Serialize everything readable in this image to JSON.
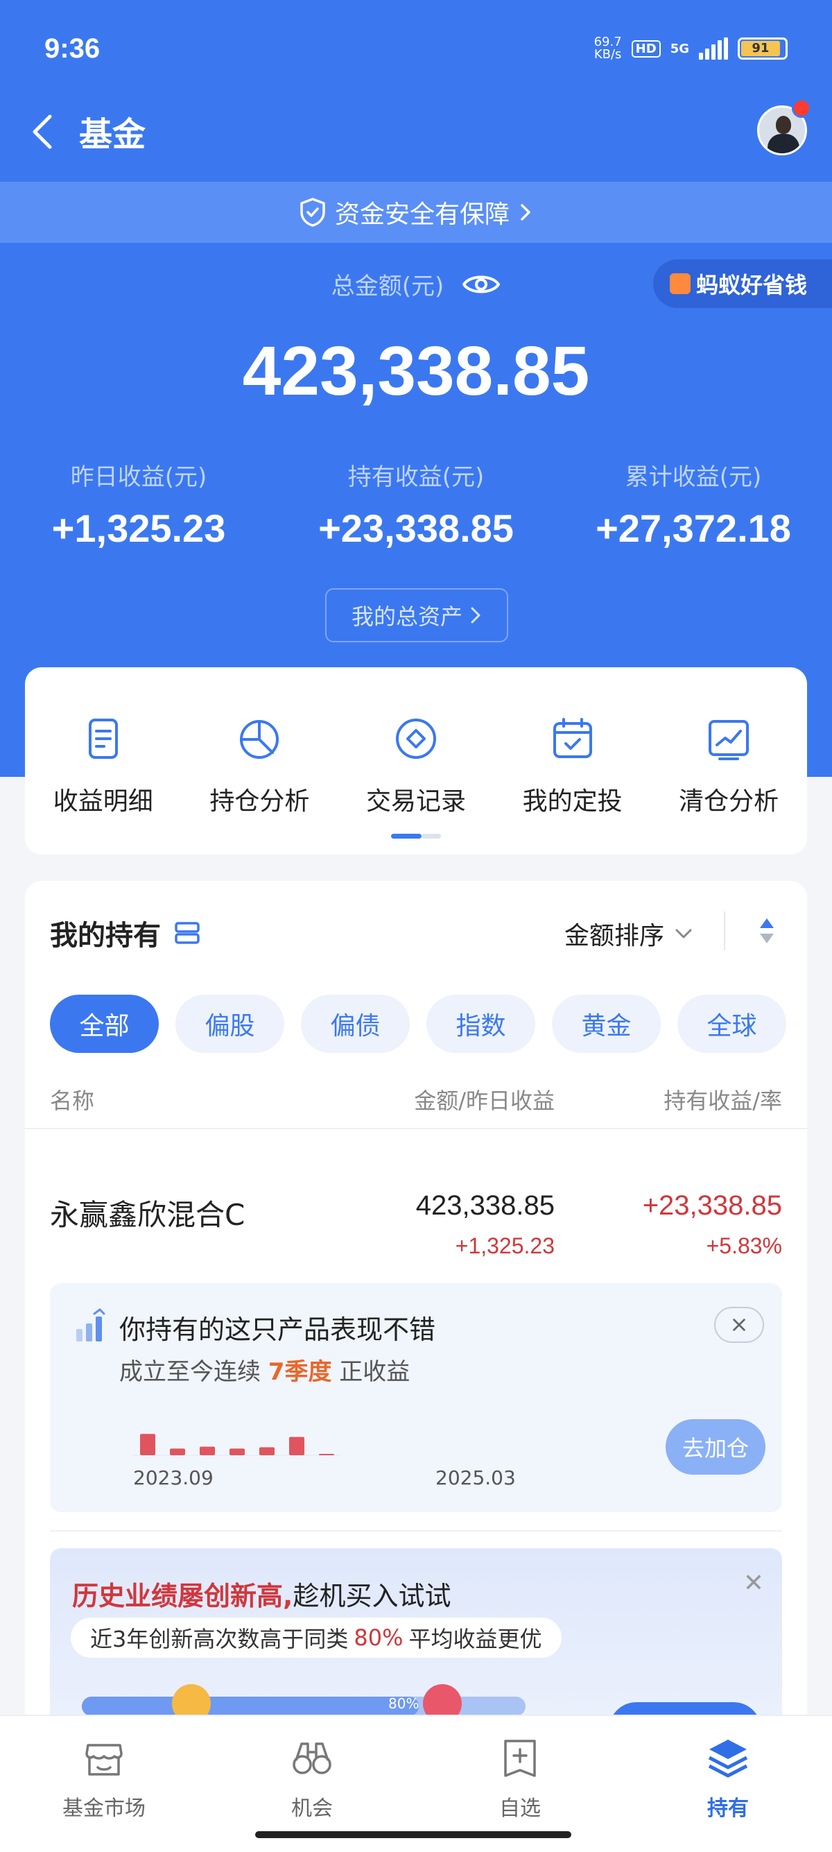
{
  "status_bar": {
    "time": "9:36",
    "net_speed_top": "69.7",
    "net_speed_bottom": "KB/s",
    "hd": "HD",
    "network": "5G",
    "battery": "91"
  },
  "nav": {
    "title": "基金"
  },
  "safety_banner": {
    "text": "资金安全有保障"
  },
  "summary": {
    "total_label": "总金额(元)",
    "total_amount": "423,338.85",
    "badge": "蚂蚁好省钱",
    "stats": [
      {
        "label": "昨日收益(元)",
        "value": "+1,325.23"
      },
      {
        "label": "持有收益(元)",
        "value": "+23,338.85"
      },
      {
        "label": "累计收益(元)",
        "value": "+27,372.18"
      }
    ],
    "assets_button": "我的总资产"
  },
  "tools": [
    {
      "label": "收益明细",
      "icon": "document-icon"
    },
    {
      "label": "持仓分析",
      "icon": "pie-chart-icon"
    },
    {
      "label": "交易记录",
      "icon": "diamond-circle-icon"
    },
    {
      "label": "我的定投",
      "icon": "calendar-check-icon"
    },
    {
      "label": "清仓分析",
      "icon": "line-chart-icon"
    }
  ],
  "holdings": {
    "title": "我的持有",
    "sort_label": "金额排序",
    "filters": [
      "全部",
      "偏股",
      "偏债",
      "指数",
      "黄金",
      "全球"
    ],
    "active_filter": "全部",
    "columns": {
      "name": "名称",
      "amount": "金额/昨日收益",
      "profit": "持有收益/率"
    },
    "funds": [
      {
        "name": "永赢鑫欣混合C",
        "amount": "423,338.85",
        "yesterday": "+1,325.23",
        "hold_profit": "+23,338.85",
        "hold_rate": "+5.83%"
      }
    ]
  },
  "performance_card": {
    "title": "你持有的这只产品表现不错",
    "sub_prefix": "成立至今连续",
    "sub_highlight": "7季度",
    "sub_suffix": "正收益",
    "x_start": "2023.09",
    "x_end": "2025.03",
    "quarterly_bars": [
      0.7,
      0.22,
      0.28,
      0.22,
      0.26,
      0.6,
      0.04
    ],
    "button": "去加仓"
  },
  "promo": {
    "title_red": "历史业绩屡创新高,",
    "title_rest": "趁机买入试试",
    "pill_prefix": "近3年创新高次数高于同类",
    "pill_pct": "80%",
    "pill_suffix": "平均收益更优",
    "track_pct": "80%"
  },
  "tabbar": [
    {
      "label": "基金市场",
      "icon": "store-icon",
      "active": false
    },
    {
      "label": "机会",
      "icon": "binoculars-icon",
      "active": false
    },
    {
      "label": "自选",
      "icon": "add-box-icon",
      "active": false
    },
    {
      "label": "持有",
      "icon": "layers-icon",
      "active": true
    }
  ],
  "colors": {
    "primary": "#3b78f0",
    "profit_red": "#d0373c",
    "highlight_orange": "#e8672c"
  }
}
